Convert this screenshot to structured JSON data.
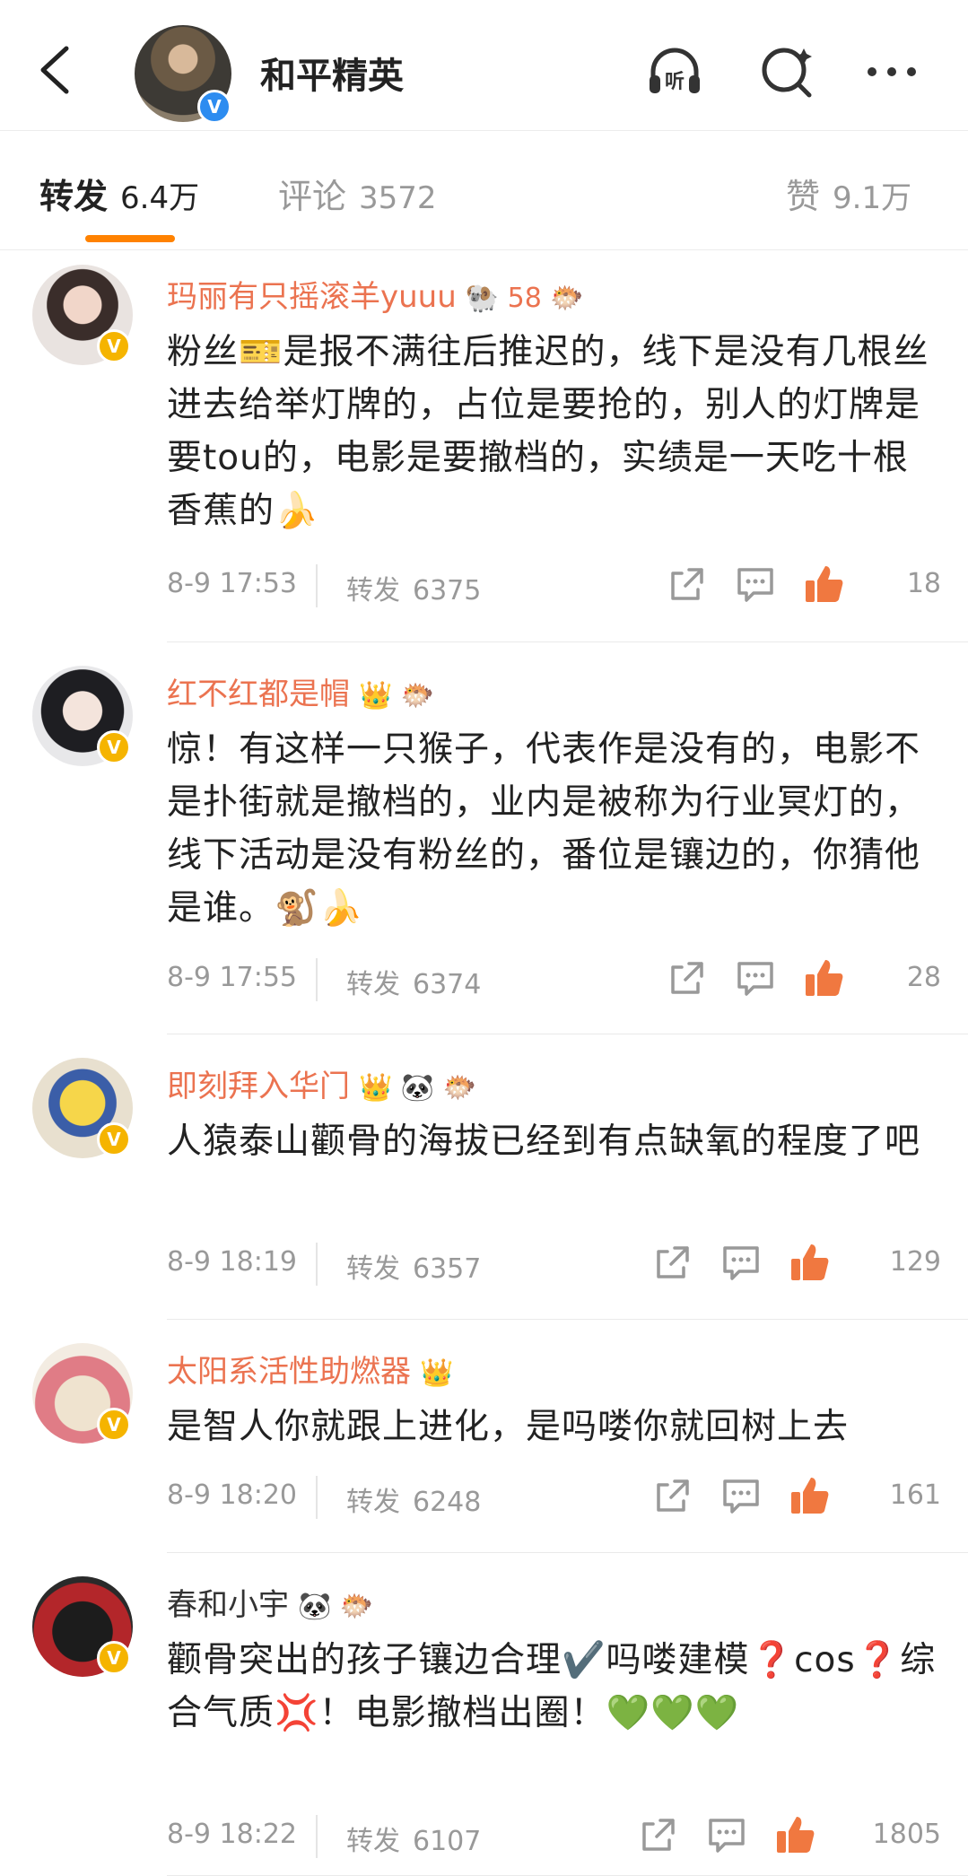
{
  "header": {
    "title": "和平精英",
    "verified": "V"
  },
  "tabs": {
    "reposts_label": "转发",
    "reposts_count": "6.4万",
    "comments_label": "评论",
    "comments_count": "3572",
    "likes_label": "赞",
    "likes_count": "9.1万"
  },
  "comments": [
    {
      "name": "玛丽有只摇滚羊yuuu",
      "badges": "🐏 58 🐡",
      "text": "粉丝🎫是报不满往后推迟的，线下是没有几根丝进去给举灯牌的，占位是要抢的，别人的灯牌是要tou的，电影是要撤档的，实绩是一天吃十根香蕉的🍌",
      "time": "8-9  17:53",
      "repost_label": "转发",
      "repost_count": "6375",
      "likes": "18"
    },
    {
      "name": "红不红都是帽",
      "badges": "👑 🐡",
      "text": "惊！有这样一只猴子，代表作是没有的，电影不是扑街就是撤档的，业内是被称为行业冥灯的，线下活动是没有粉丝的，番位是镶边的，你猜他是谁。🐒🍌",
      "time": "8-9  17:55",
      "repost_label": "转发",
      "repost_count": "6374",
      "likes": "28"
    },
    {
      "name": "即刻拜入华门",
      "badges": "👑 🐼 🐡",
      "text": "人猿泰山颧骨的海拔已经到有点缺氧的程度了吧",
      "time": "8-9  18:19",
      "repost_label": "转发",
      "repost_count": "6357",
      "likes": "129"
    },
    {
      "name": "太阳系活性助燃器",
      "badges": "👑",
      "text": "是智人你就跟上进化，是吗喽你就回树上去",
      "time": "8-9  18:20",
      "repost_label": "转发",
      "repost_count": "6248",
      "likes": "161"
    },
    {
      "name": "春和小宇",
      "badges": "🐼 🐡",
      "text": "颧骨突出的孩子镶边合理✔️吗喽建模❓cos❓综合气质💢！电影撤档出圈！💚💚💚",
      "time": "8-9  18:22",
      "repost_label": "转发",
      "repost_count": "6107",
      "likes": "1805"
    }
  ]
}
